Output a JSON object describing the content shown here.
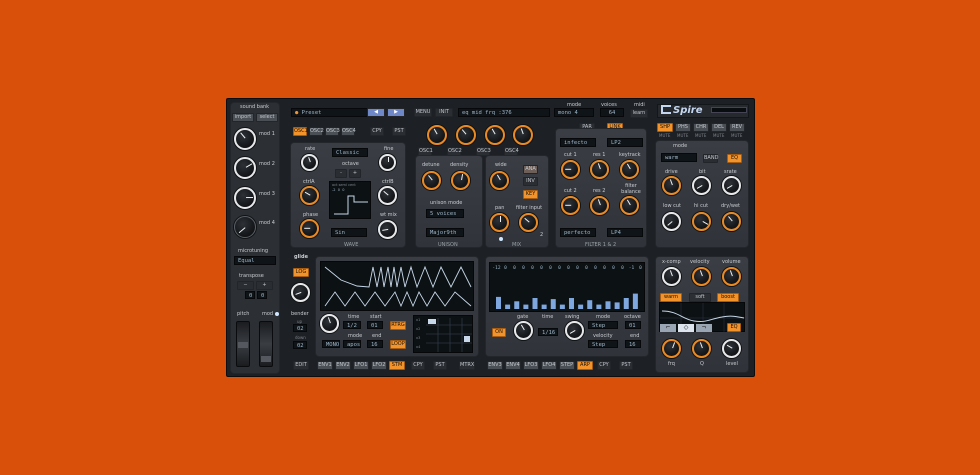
{
  "sidebar": {
    "sound_bank": "sound bank",
    "import": "import",
    "select": "select",
    "mods": [
      "mod 1",
      "mod 2",
      "mod 3",
      "mod 4"
    ],
    "microtuning": "microtuning",
    "microtuning_value": "Equal",
    "transpose": "transpose",
    "transpose_values": [
      "0",
      "0"
    ],
    "pitch": "pitch",
    "mod": "mod"
  },
  "header": {
    "preset": "Preset",
    "menu": "MENU",
    "init": "INIT",
    "lcd": "eq mid frq  :376",
    "mode_label": "mode",
    "mode_value": "mono 4",
    "voices_label": "voices",
    "voices_value": "64",
    "midi_label": "midi",
    "learn": "learn",
    "logo": "Spire"
  },
  "osc": {
    "tabs": [
      "OSC1",
      "OSC2",
      "OSC3",
      "OSC4"
    ],
    "copy": "CPY",
    "paste": "PST",
    "knobs": [
      "OSC1",
      "OSC2",
      "OSC3",
      "OSC4"
    ],
    "wave": {
      "ctrla": "ctrlA",
      "ctrlb": "ctrlB",
      "octave": "octave",
      "rate": "rate",
      "fine": "fine",
      "phase": "phase",
      "wt_mix": "wt mix",
      "classic": "Classic",
      "sin": "Sin",
      "title": "WAVE",
      "oct_labels": [
        "oct",
        "semi",
        "cent"
      ],
      "oct_values": [
        "-2",
        "0",
        "0"
      ]
    },
    "unison": {
      "detune": "detune",
      "density": "density",
      "unison_mode": "unison mode",
      "voices": "5 voices",
      "chord": "Major9th",
      "title": "UNISON"
    },
    "mix": {
      "wide": "wide",
      "pan": "pan",
      "filter_input": "filter input",
      "buttons": [
        "ANA",
        "INV",
        "KEY"
      ],
      "title": "MIX",
      "num": "2"
    }
  },
  "filter": {
    "par": "PAR",
    "lin": "LINK",
    "type1": "infecto",
    "type2": "LP2",
    "cut1": "cut 1",
    "res1": "res 1",
    "keytrack": "keytrack",
    "cut2": "cut 2",
    "res2": "res 2",
    "balance": "filter balance",
    "mode1": "perfecto",
    "mode2": "LP4",
    "title": "FILTER 1 & 2"
  },
  "fx": {
    "tabs": [
      "SHP",
      "PHS",
      "CHR",
      "DEL",
      "REV"
    ],
    "mute": "MUTE",
    "mode": "mode",
    "mode_value": "warm",
    "band": "BAND",
    "eq": "EQ",
    "drive": "drive",
    "bit": "bit",
    "srate": "srate",
    "low_cut": "low cut",
    "hi_cut": "hi cut",
    "dry_wet": "dry/wet"
  },
  "glide": {
    "glide": "glide",
    "log": "LOG",
    "bender_label": "bender",
    "up": "up",
    "down": "down",
    "up_val": "02",
    "down_val": "02"
  },
  "envelope": {
    "time": "time",
    "start": "start",
    "end": "end",
    "mode": "mode",
    "time_val": "1/2",
    "start_val": "01",
    "end_val": "16",
    "mode_val": "MONO",
    "apos": "apos",
    "retrig": "RTRG",
    "loop": "LOOP",
    "tabs": [
      "ENV1",
      "ENV2",
      "LFO1",
      "LFO2",
      "STM"
    ],
    "mod_tabs": [
      "EDIT"
    ],
    "cpy": "CPY",
    "pst": "PST",
    "mtx": "MTRX",
    "grid_labels": [
      "x1",
      "x2",
      "x3",
      "x4"
    ]
  },
  "arp": {
    "steps": [
      "-12",
      "0",
      "0",
      "0",
      "0",
      "0",
      "0",
      "0",
      "0",
      "0",
      "0",
      "0",
      "0",
      "0",
      "0",
      "-1",
      "0"
    ],
    "on": "ON",
    "gate": "gate",
    "time": "time",
    "time_val": "1/16",
    "swing": "swing",
    "mode": "mode",
    "mode_val": "Step",
    "octave": "octave",
    "octave_val": "01",
    "velocity": "velocity",
    "vel_val": "Step",
    "end": "end",
    "end_val": "16",
    "tabs": [
      "ENV3",
      "ENV4",
      "LFO3",
      "LFO4",
      "STEP",
      "ARP"
    ],
    "cpy": "CPY",
    "pst": "PST",
    "bars": [
      0.55,
      0.2,
      0.35,
      0.2,
      0.5,
      0.2,
      0.45,
      0.2,
      0.5,
      0.2,
      0.4,
      0.2,
      0.35,
      0.3,
      0.5,
      0.7
    ]
  },
  "eq": {
    "xcomp": "x-comp",
    "velocity": "velocity",
    "volume": "volume",
    "warm": "warm",
    "soft": "soft",
    "boost": "boost",
    "eq": "EQ",
    "frq": "frq",
    "q": "Q",
    "level": "level"
  },
  "colors": {
    "orange": "#f2932b",
    "panel": "#34383e",
    "bg": "#d8500a"
  }
}
